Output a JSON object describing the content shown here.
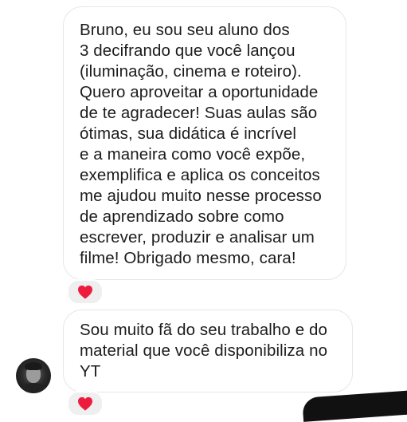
{
  "messages": [
    {
      "lines": [
        "Bruno, eu sou seu aluno dos",
        "3 decifrando que você lançou",
        "(iluminação, cinema e roteiro).",
        "Quero aproveitar a oportunidade",
        "de te agradecer! Suas aulas são",
        "ótimas, sua didática é incrível",
        "e a maneira como você expõe,",
        "exemplifica e aplica os conceitos",
        "me ajudou muito nesse processo",
        "de aprendizado sobre como",
        "escrever, produzir e analisar um",
        "filme! Obrigado mesmo, cara!"
      ],
      "reaction_icon": "heart-icon"
    },
    {
      "lines": [
        "Sou muito fã do seu trabalho e do",
        "material que você disponibiliza no",
        "YT"
      ],
      "reaction_icon": "heart-icon"
    }
  ],
  "colors": {
    "bubble_border": "#e6e6e6",
    "text": "#1c1c1c",
    "heart": "#ed1c3c",
    "reaction_bg": "#efefef"
  }
}
